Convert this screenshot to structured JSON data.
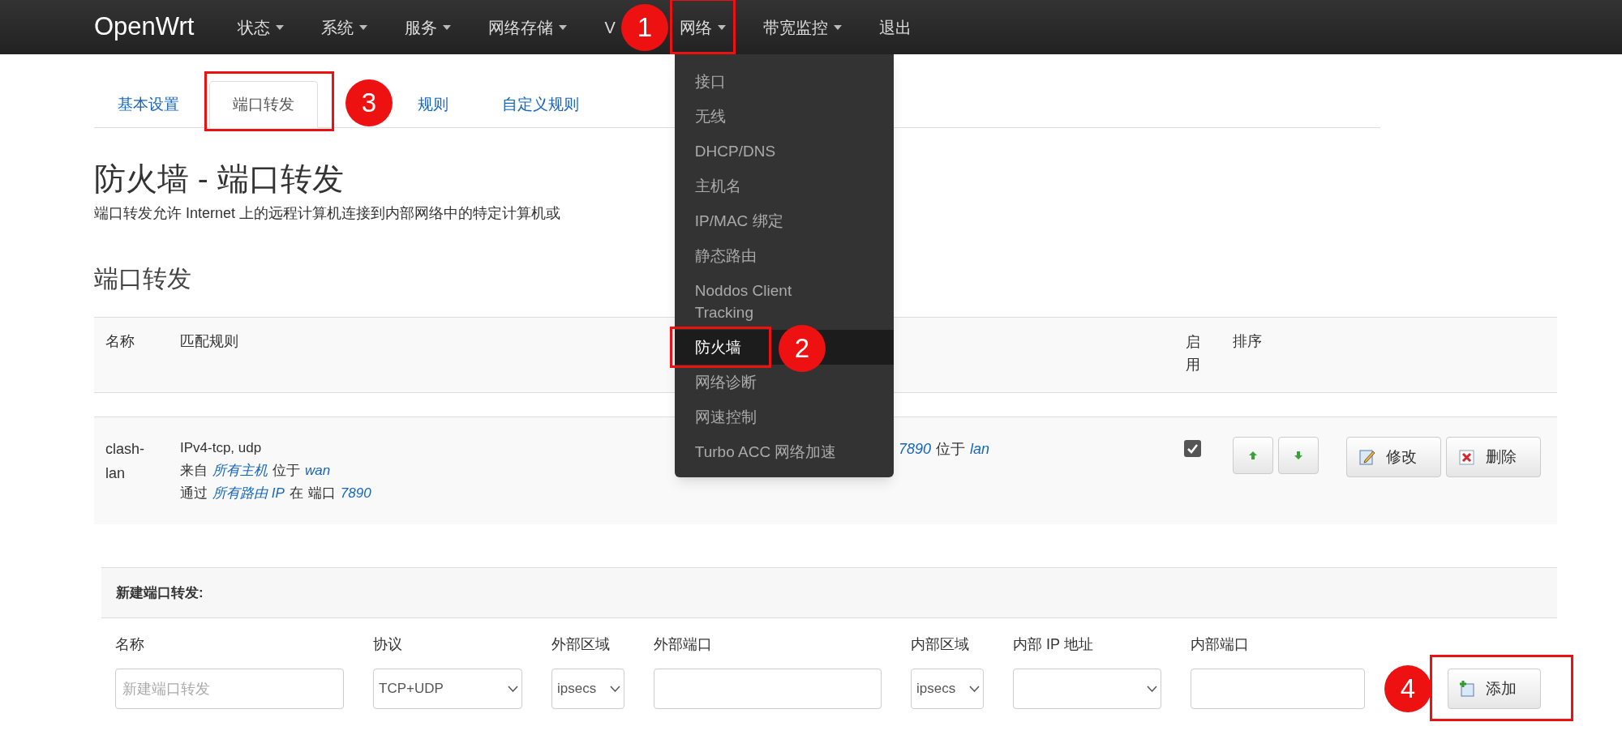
{
  "brand": "OpenWrt",
  "nav": [
    {
      "label": "状态",
      "has_menu": true
    },
    {
      "label": "系统",
      "has_menu": true
    },
    {
      "label": "服务",
      "has_menu": true
    },
    {
      "label": "网络存储",
      "has_menu": true
    },
    {
      "label": "V",
      "has_menu": false
    },
    {
      "label": "网络",
      "has_menu": true,
      "menu": [
        {
          "label": "接口",
          "selected": false
        },
        {
          "label": "无线",
          "selected": false
        },
        {
          "label": "DHCP/DNS",
          "selected": false
        },
        {
          "label": "主机名",
          "selected": false
        },
        {
          "label": "IP/MAC 绑定",
          "selected": false
        },
        {
          "label": "静态路由",
          "selected": false
        },
        {
          "label": "Noddos Client Tracking",
          "selected": false
        },
        {
          "label": "防火墙",
          "selected": true
        },
        {
          "label": "网络诊断",
          "selected": false
        },
        {
          "label": "网速控制",
          "selected": false
        },
        {
          "label": "Turbo ACC 网络加速",
          "selected": false
        }
      ]
    },
    {
      "label": "带宽监控",
      "has_menu": true
    },
    {
      "label": "退出",
      "has_menu": false
    }
  ],
  "tabs": [
    {
      "label": "基本设置",
      "selected": false
    },
    {
      "label": "端口转发",
      "selected": true
    },
    {
      "label": "规则",
      "selected": false
    },
    {
      "label": "自定义规则",
      "selected": false
    }
  ],
  "title": "防火墙 - 端口转发",
  "description": "端口转发允许 Internet 上的远程计算机连接到内部网络中的特定计算机或",
  "section_title": "端口转发",
  "table": {
    "columns": [
      "名称",
      "匹配规则",
      "启用",
      "排序"
    ],
    "rows": [
      {
        "name": "clash-lan",
        "match": [
          [
            {
              "text": "IPv4-tcp, udp",
              "link": false
            }
          ],
          [
            {
              "text": "来自",
              "link": false
            },
            {
              "text": "所有主机",
              "link": true
            },
            {
              "text": "位于",
              "link": false
            },
            {
              "text": "wan",
              "link": true
            }
          ],
          [
            {
              "text": "通过",
              "link": false
            },
            {
              "text": "所有路由 IP",
              "link": true
            },
            {
              "text": "在",
              "link": false
            },
            {
              "text": "端口",
              "link": false
            },
            {
              "text": "7890",
              "link": true
            }
          ]
        ],
        "action": [
          {
            "text": "7890",
            "link": true
          },
          {
            "text": "位于",
            "link": false
          },
          {
            "text": "lan",
            "link": true
          }
        ],
        "enabled": true,
        "edit": "修改",
        "delete": "删除"
      }
    ]
  },
  "new_rule": {
    "title": "新建端口转发:",
    "fields": [
      {
        "label": "名称",
        "kind": "text",
        "placeholder": "新建端口转发"
      },
      {
        "label": "协议",
        "kind": "select",
        "value": "TCP+UDP"
      },
      {
        "label": "外部区域",
        "kind": "select",
        "value": "ipsecs"
      },
      {
        "label": "外部端口",
        "kind": "text"
      },
      {
        "label": "内部区域",
        "kind": "select",
        "value": "ipsecs"
      },
      {
        "label": "内部 IP 地址",
        "kind": "select"
      },
      {
        "label": "内部端口",
        "kind": "text"
      }
    ],
    "add": "添加"
  },
  "annotations": [
    "1",
    "2",
    "3",
    "4"
  ]
}
